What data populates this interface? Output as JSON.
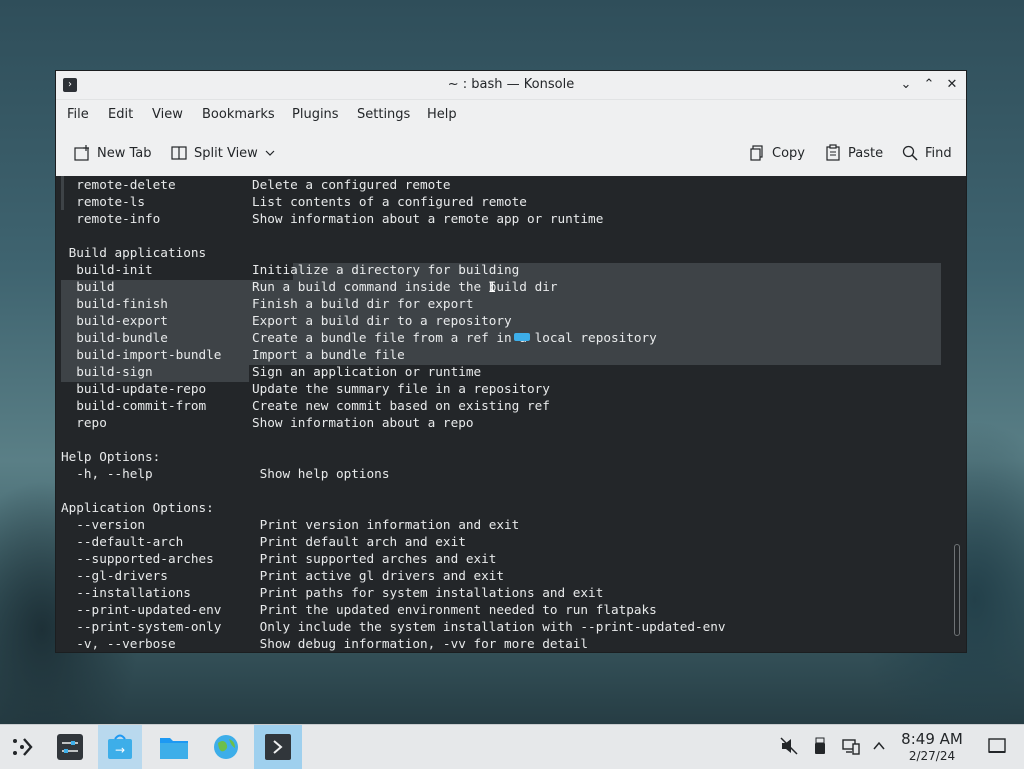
{
  "window": {
    "title": "~ : bash — Konsole",
    "controls": {
      "minimize": "⌄",
      "maximize": "⌃",
      "close": "✕"
    }
  },
  "menu": [
    "File",
    "Edit",
    "View",
    "Bookmarks",
    "Plugins",
    "Settings",
    "Help"
  ],
  "toolbar": {
    "new_tab": "New Tab",
    "split_view": "Split View",
    "copy": "Copy",
    "paste": "Paste",
    "find": "Find"
  },
  "terminal": {
    "lines": [
      "  remote-delete          Delete a configured remote",
      "  remote-ls              List contents of a configured remote",
      "  remote-info            Show information about a remote app or runtime",
      "",
      " Build applications",
      "  build-init             Initialize a directory for building",
      "  build                  Run a build command inside the build dir",
      "  build-finish           Finish a build dir for export",
      "  build-export           Export a build dir to a repository",
      "  build-bundle           Create a bundle file from a ref in a local repository",
      "  build-import-bundle    Import a bundle file",
      "  build-sign             Sign an application or runtime",
      "  build-update-repo      Update the summary file in a repository",
      "  build-commit-from      Create new commit based on existing ref",
      "  repo                   Show information about a repo",
      "",
      "Help Options:",
      "  -h, --help              Show help options",
      "",
      "Application Options:",
      "  --version               Print version information and exit",
      "  --default-arch          Print default arch and exit",
      "  --supported-arches      Print supported arches and exit",
      "  --gl-drivers            Print active gl drivers and exit",
      "  --installations         Print paths for system installations and exit",
      "  --print-updated-env     Print the updated environment needed to run flatpaks",
      "  --print-system-only     Only include the system installation with --print-updated-env",
      "  -v, --verbose           Show debug information, -vv for more detail"
    ]
  },
  "taskbar": {
    "apps": [
      "app-launcher-icon",
      "system-settings-icon",
      "discover-icon",
      "file-manager-icon",
      "web-browser-icon",
      "konsole-icon"
    ],
    "clock_time": "8:49 AM",
    "clock_date": "2/27/24"
  },
  "colors": {
    "accent": "#3daee9",
    "terminal_bg": "#232629",
    "chrome_bg": "#eff0f1"
  }
}
